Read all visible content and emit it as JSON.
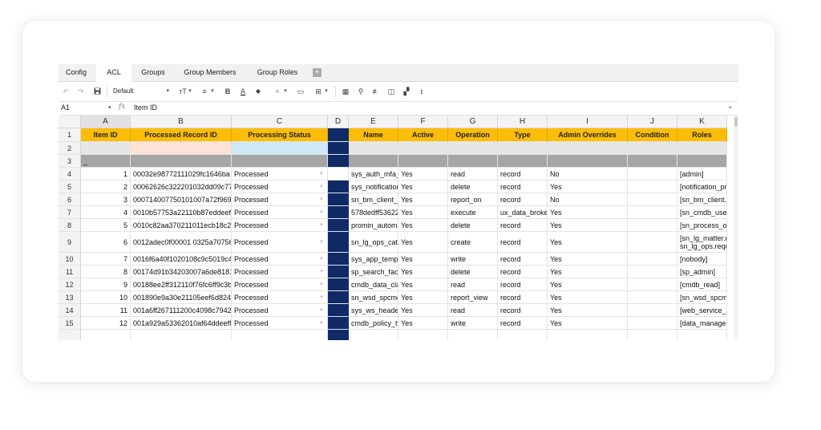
{
  "tabs": [
    "Config",
    "ACL",
    "Groups",
    "Group Members",
    "Group Roles"
  ],
  "active_tab": "ACL",
  "toolbar": {
    "undo": "↶",
    "redo": "↷",
    "save": "💾",
    "font": "Default",
    "font_size": "ᴛT",
    "align": "≡",
    "bold": "B",
    "text_color": "A",
    "fill_color": "◆",
    "valign": "÷",
    "wrap": "▭",
    "borders": "⊞",
    "insert": "▦",
    "search": "⚲",
    "filter": "≢",
    "chart": "◫",
    "group": "▞",
    "download": "⭳",
    "dropdown": "▾"
  },
  "formula_bar": {
    "cell_ref": "A1",
    "fx": "fx",
    "value": "Item ID",
    "expand": "⌄"
  },
  "columns": [
    "A",
    "B",
    "C",
    "D",
    "E",
    "F",
    "G",
    "H",
    "I",
    "J",
    "K"
  ],
  "header_row": [
    "Item ID",
    "Processed Record ID",
    "Processing Status",
    "",
    "Name",
    "Active",
    "Operation",
    "Type",
    "Admin Overrides",
    "Condition",
    "Roles"
  ],
  "row3_marker": "_",
  "rows": [
    {
      "row": "4",
      "id": "1",
      "rec": "00032e98772111029fc1646ba",
      "status": "Processed",
      "name": "sys_auth_mfa_",
      "active": "Yes",
      "op": "read",
      "type": "record",
      "admin": "No",
      "roles": [
        "[admin]"
      ]
    },
    {
      "row": "5",
      "id": "2",
      "rec": "00062626c322201032dd09c77",
      "status": "Processed",
      "name": "sys_notification",
      "active": "Yes",
      "op": "delete",
      "type": "record",
      "admin": "Yes",
      "roles": [
        "[notification_prov"
      ]
    },
    {
      "row": "6",
      "id": "3",
      "rec": "000714007750101007a72f969",
      "status": "Processed",
      "name": "sn_bm_client_r",
      "active": "Yes",
      "op": "report_on",
      "type": "record",
      "admin": "No",
      "roles": [
        "[sn_bm_client.be"
      ]
    },
    {
      "row": "7",
      "id": "4",
      "rec": "0010b57753a22110b87eddeeff",
      "status": "Processed",
      "name": "578dedff53622",
      "active": "Yes",
      "op": "execute",
      "type": "ux_data_broke",
      "admin": "Yes",
      "roles": [
        "[sn_cmdb_user]"
      ]
    },
    {
      "row": "8",
      "id": "5",
      "rec": "0010c82aa370211011ecb18c2e",
      "status": "Processed",
      "name": "promin_automa",
      "active": "Yes",
      "op": "delete",
      "type": "record",
      "admin": "Yes",
      "roles": [
        "[sn_process_opti"
      ]
    },
    {
      "row": "9",
      "id": "6",
      "rec": "0012adec0f00001 0325a70756e",
      "status": "Processed",
      "name": "sn_lg_ops_cate",
      "active": "Yes",
      "op": "create",
      "type": "record",
      "admin": "Yes",
      "roles": [
        "[sn_lg_matter.ma",
        "sn_lg_ops.reque"
      ]
    },
    {
      "row": "10",
      "id": "7",
      "rec": "0016f6a40f1020108c9c5019c47",
      "status": "Processed",
      "name": "sys_app_templ",
      "active": "Yes",
      "op": "write",
      "type": "record",
      "admin": "Yes",
      "roles": [
        "[nobody]"
      ]
    },
    {
      "row": "11",
      "id": "8",
      "rec": "00174d91b34203007a6de8181",
      "status": "Processed",
      "name": "sp_search_face",
      "active": "Yes",
      "op": "delete",
      "type": "record",
      "admin": "Yes",
      "roles": [
        "[sp_admin]"
      ]
    },
    {
      "row": "12",
      "id": "9",
      "rec": "00188ee2ff312110f76fc6ff9c3bf",
      "status": "Processed",
      "name": "cmdb_data_cla",
      "active": "Yes",
      "op": "read",
      "type": "record",
      "admin": "Yes",
      "roles": [
        "[cmdb_read]"
      ]
    },
    {
      "row": "13",
      "id": "10",
      "rec": "001890e9a30e21105eef6d8246",
      "status": "Processed",
      "name": "sn_wsd_spcmg",
      "active": "Yes",
      "op": "report_view",
      "type": "record",
      "admin": "Yes",
      "roles": [
        "[sn_wsd_spcmgm"
      ]
    },
    {
      "row": "14",
      "id": "11",
      "rec": "001a6ff267111200c4098c79424",
      "status": "Processed",
      "name": "sys_ws_heade",
      "active": "Yes",
      "op": "read",
      "type": "record",
      "admin": "Yes",
      "roles": [
        "[web_service_adr"
      ]
    },
    {
      "row": "15",
      "id": "12",
      "rec": "001a929a53362010af64ddeeff7",
      "status": "Processed",
      "name": "cmdb_policy_ty",
      "active": "Yes",
      "op": "write",
      "type": "record",
      "admin": "Yes",
      "roles": [
        "[data_manager_a"
      ]
    }
  ],
  "colors": {
    "header_fill": "#fbbd08",
    "accent_column": "#0f2a66",
    "peach": "#fce3d6",
    "light_blue": "#cfe8f6"
  }
}
